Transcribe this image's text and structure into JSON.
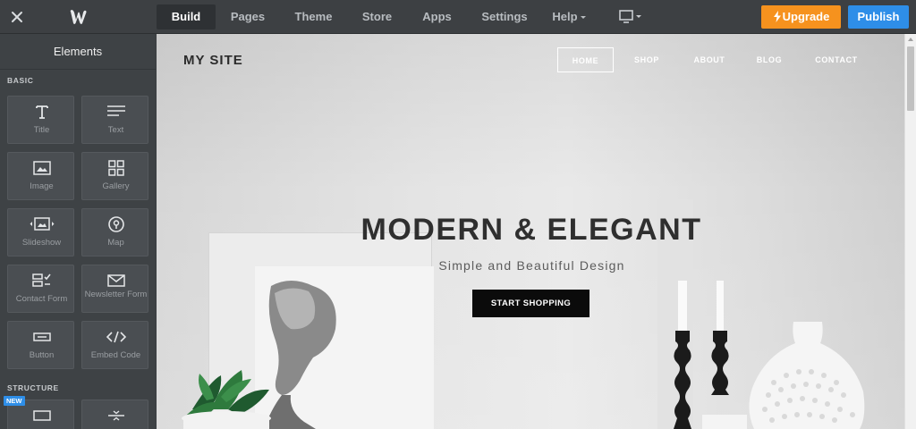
{
  "topbar": {
    "nav": [
      {
        "label": "Build",
        "active": true
      },
      {
        "label": "Pages"
      },
      {
        "label": "Theme"
      },
      {
        "label": "Store"
      },
      {
        "label": "Apps"
      },
      {
        "label": "Settings"
      },
      {
        "label": "Help"
      }
    ],
    "upgrade_label": "Upgrade",
    "publish_label": "Publish",
    "colors": {
      "upgrade": "#f6921e",
      "publish": "#2e8ee8",
      "bar": "#3d4043"
    }
  },
  "sidebar": {
    "title": "Elements",
    "section_basic": "BASIC",
    "section_structure": "STRUCTURE",
    "new_badge": "NEW",
    "tiles": [
      {
        "label": "Title",
        "icon": "title-icon"
      },
      {
        "label": "Text",
        "icon": "text-icon"
      },
      {
        "label": "Image",
        "icon": "image-icon"
      },
      {
        "label": "Gallery",
        "icon": "gallery-icon"
      },
      {
        "label": "Slideshow",
        "icon": "slideshow-icon"
      },
      {
        "label": "Map",
        "icon": "map-pin-icon"
      },
      {
        "label": "Contact Form",
        "icon": "contact-form-icon"
      },
      {
        "label": "Newsletter Form",
        "icon": "newsletter-icon"
      },
      {
        "label": "Button",
        "icon": "button-icon"
      },
      {
        "label": "Embed Code",
        "icon": "embed-code-icon"
      }
    ]
  },
  "site": {
    "logo": "MY SITE",
    "nav": [
      "HOME",
      "SHOP",
      "ABOUT",
      "BLOG",
      "CONTACT"
    ],
    "hero_title": "MODERN & ELEGANT",
    "hero_subtitle": "Simple and Beautiful Design",
    "hero_button": "START SHOPPING"
  }
}
